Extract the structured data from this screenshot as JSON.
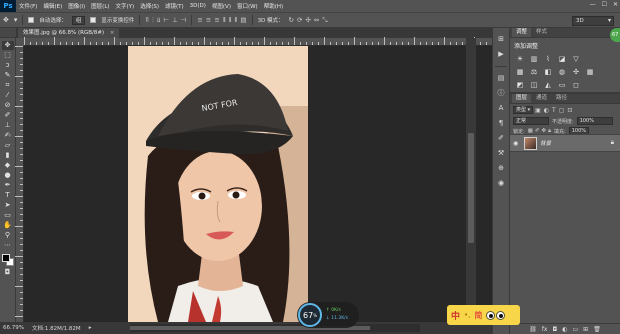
{
  "app": {
    "logo": "Ps"
  },
  "menu": [
    "文件(F)",
    "编辑(E)",
    "图像(I)",
    "图层(L)",
    "文字(Y)",
    "选择(S)",
    "滤镜(T)",
    "3D(D)",
    "视图(V)",
    "窗口(W)",
    "帮助(H)"
  ],
  "window_controls": {
    "minimize": "—",
    "maximize": "☐",
    "close": "✕"
  },
  "options": {
    "auto_select_label": "自动选择：",
    "auto_select_value": "组",
    "transform_label": "显示变换控件",
    "mode3d_label": "3D 模式：",
    "workspace": "3D"
  },
  "document": {
    "tab_title": "效果图.jpg @ 66.8% (RGB/8#)",
    "close": "×"
  },
  "status": {
    "zoom": "66.79%",
    "doc_info": "文档:1.82M/1.82M"
  },
  "net_widget": {
    "percent": "67",
    "percent_unit": "%",
    "up": "0K/s",
    "down": "11.3K/s"
  },
  "panels": {
    "tabs_top": [
      "调整",
      "样式"
    ],
    "adjust_title": "添加调整",
    "tabs_layers": [
      "图层",
      "通道",
      "路径"
    ],
    "filter_type": "类型",
    "blend_mode": "正常",
    "opacity_label": "不透明度:",
    "opacity_value": "100%",
    "lock_label": "锁定:",
    "fill_label": "填充:",
    "fill_value": "100%",
    "layer_name": "背景"
  },
  "ime": {
    "zh": "中",
    "dot": "•,",
    "jian": "简"
  },
  "badge": {
    "text": "67"
  }
}
